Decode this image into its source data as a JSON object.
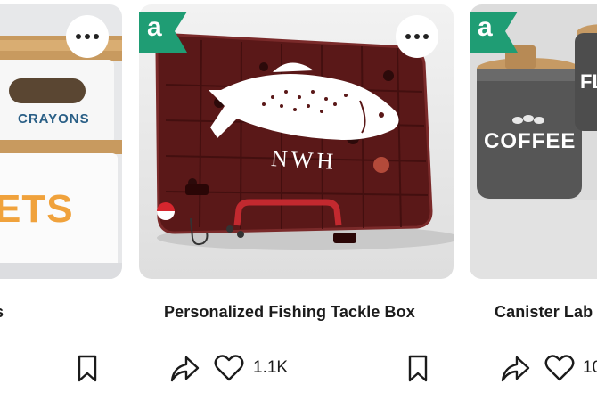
{
  "cards": [
    {
      "title": "s",
      "image_alt": "Storage bins with bamboo lids labeled crayons",
      "image_text": [
        "CRAYONS",
        "ETS"
      ],
      "more_icon": "more-horizontal-icon",
      "save_icon": "bookmark-icon"
    },
    {
      "title": "Personalized Fishing Tackle Box",
      "image_alt": "Dark red fishing tackle box with white trout decal and NWH monogram",
      "image_text": [
        "NWH"
      ],
      "badge_letter": "a",
      "badge_color": "#1f9d74",
      "more_icon": "more-horizontal-icon",
      "share_icon": "share-icon",
      "like_icon": "heart-icon",
      "likes": "1.1K",
      "save_icon": "bookmark-icon"
    },
    {
      "title": "Canister Lab",
      "image_alt": "Gray canisters with wooden lids labeled coffee",
      "image_text": [
        "COFFEE",
        "FL"
      ],
      "badge_letter": "a",
      "badge_color": "#1f9d74",
      "share_icon": "share-icon",
      "like_icon": "heart-icon",
      "likes": "10"
    }
  ]
}
